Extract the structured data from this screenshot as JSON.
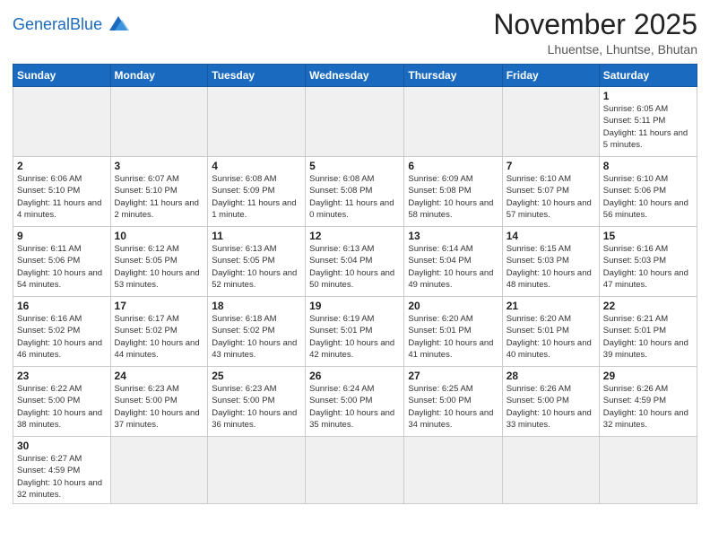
{
  "header": {
    "logo_general": "General",
    "logo_blue": "Blue",
    "month_title": "November 2025",
    "subtitle": "Lhuentse, Lhuntse, Bhutan"
  },
  "weekdays": [
    "Sunday",
    "Monday",
    "Tuesday",
    "Wednesday",
    "Thursday",
    "Friday",
    "Saturday"
  ],
  "weeks": [
    [
      {
        "day": "",
        "info": ""
      },
      {
        "day": "",
        "info": ""
      },
      {
        "day": "",
        "info": ""
      },
      {
        "day": "",
        "info": ""
      },
      {
        "day": "",
        "info": ""
      },
      {
        "day": "",
        "info": ""
      },
      {
        "day": "1",
        "info": "Sunrise: 6:05 AM\nSunset: 5:11 PM\nDaylight: 11 hours\nand 5 minutes."
      }
    ],
    [
      {
        "day": "2",
        "info": "Sunrise: 6:06 AM\nSunset: 5:10 PM\nDaylight: 11 hours\nand 4 minutes."
      },
      {
        "day": "3",
        "info": "Sunrise: 6:07 AM\nSunset: 5:10 PM\nDaylight: 11 hours\nand 2 minutes."
      },
      {
        "day": "4",
        "info": "Sunrise: 6:08 AM\nSunset: 5:09 PM\nDaylight: 11 hours\nand 1 minute."
      },
      {
        "day": "5",
        "info": "Sunrise: 6:08 AM\nSunset: 5:08 PM\nDaylight: 11 hours\nand 0 minutes."
      },
      {
        "day": "6",
        "info": "Sunrise: 6:09 AM\nSunset: 5:08 PM\nDaylight: 10 hours\nand 58 minutes."
      },
      {
        "day": "7",
        "info": "Sunrise: 6:10 AM\nSunset: 5:07 PM\nDaylight: 10 hours\nand 57 minutes."
      },
      {
        "day": "8",
        "info": "Sunrise: 6:10 AM\nSunset: 5:06 PM\nDaylight: 10 hours\nand 56 minutes."
      }
    ],
    [
      {
        "day": "9",
        "info": "Sunrise: 6:11 AM\nSunset: 5:06 PM\nDaylight: 10 hours\nand 54 minutes."
      },
      {
        "day": "10",
        "info": "Sunrise: 6:12 AM\nSunset: 5:05 PM\nDaylight: 10 hours\nand 53 minutes."
      },
      {
        "day": "11",
        "info": "Sunrise: 6:13 AM\nSunset: 5:05 PM\nDaylight: 10 hours\nand 52 minutes."
      },
      {
        "day": "12",
        "info": "Sunrise: 6:13 AM\nSunset: 5:04 PM\nDaylight: 10 hours\nand 50 minutes."
      },
      {
        "day": "13",
        "info": "Sunrise: 6:14 AM\nSunset: 5:04 PM\nDaylight: 10 hours\nand 49 minutes."
      },
      {
        "day": "14",
        "info": "Sunrise: 6:15 AM\nSunset: 5:03 PM\nDaylight: 10 hours\nand 48 minutes."
      },
      {
        "day": "15",
        "info": "Sunrise: 6:16 AM\nSunset: 5:03 PM\nDaylight: 10 hours\nand 47 minutes."
      }
    ],
    [
      {
        "day": "16",
        "info": "Sunrise: 6:16 AM\nSunset: 5:02 PM\nDaylight: 10 hours\nand 46 minutes."
      },
      {
        "day": "17",
        "info": "Sunrise: 6:17 AM\nSunset: 5:02 PM\nDaylight: 10 hours\nand 44 minutes."
      },
      {
        "day": "18",
        "info": "Sunrise: 6:18 AM\nSunset: 5:02 PM\nDaylight: 10 hours\nand 43 minutes."
      },
      {
        "day": "19",
        "info": "Sunrise: 6:19 AM\nSunset: 5:01 PM\nDaylight: 10 hours\nand 42 minutes."
      },
      {
        "day": "20",
        "info": "Sunrise: 6:20 AM\nSunset: 5:01 PM\nDaylight: 10 hours\nand 41 minutes."
      },
      {
        "day": "21",
        "info": "Sunrise: 6:20 AM\nSunset: 5:01 PM\nDaylight: 10 hours\nand 40 minutes."
      },
      {
        "day": "22",
        "info": "Sunrise: 6:21 AM\nSunset: 5:01 PM\nDaylight: 10 hours\nand 39 minutes."
      }
    ],
    [
      {
        "day": "23",
        "info": "Sunrise: 6:22 AM\nSunset: 5:00 PM\nDaylight: 10 hours\nand 38 minutes."
      },
      {
        "day": "24",
        "info": "Sunrise: 6:23 AM\nSunset: 5:00 PM\nDaylight: 10 hours\nand 37 minutes."
      },
      {
        "day": "25",
        "info": "Sunrise: 6:23 AM\nSunset: 5:00 PM\nDaylight: 10 hours\nand 36 minutes."
      },
      {
        "day": "26",
        "info": "Sunrise: 6:24 AM\nSunset: 5:00 PM\nDaylight: 10 hours\nand 35 minutes."
      },
      {
        "day": "27",
        "info": "Sunrise: 6:25 AM\nSunset: 5:00 PM\nDaylight: 10 hours\nand 34 minutes."
      },
      {
        "day": "28",
        "info": "Sunrise: 6:26 AM\nSunset: 5:00 PM\nDaylight: 10 hours\nand 33 minutes."
      },
      {
        "day": "29",
        "info": "Sunrise: 6:26 AM\nSunset: 4:59 PM\nDaylight: 10 hours\nand 32 minutes."
      }
    ],
    [
      {
        "day": "30",
        "info": "Sunrise: 6:27 AM\nSunset: 4:59 PM\nDaylight: 10 hours\nand 32 minutes."
      },
      {
        "day": "",
        "info": ""
      },
      {
        "day": "",
        "info": ""
      },
      {
        "day": "",
        "info": ""
      },
      {
        "day": "",
        "info": ""
      },
      {
        "day": "",
        "info": ""
      },
      {
        "day": "",
        "info": ""
      }
    ]
  ]
}
